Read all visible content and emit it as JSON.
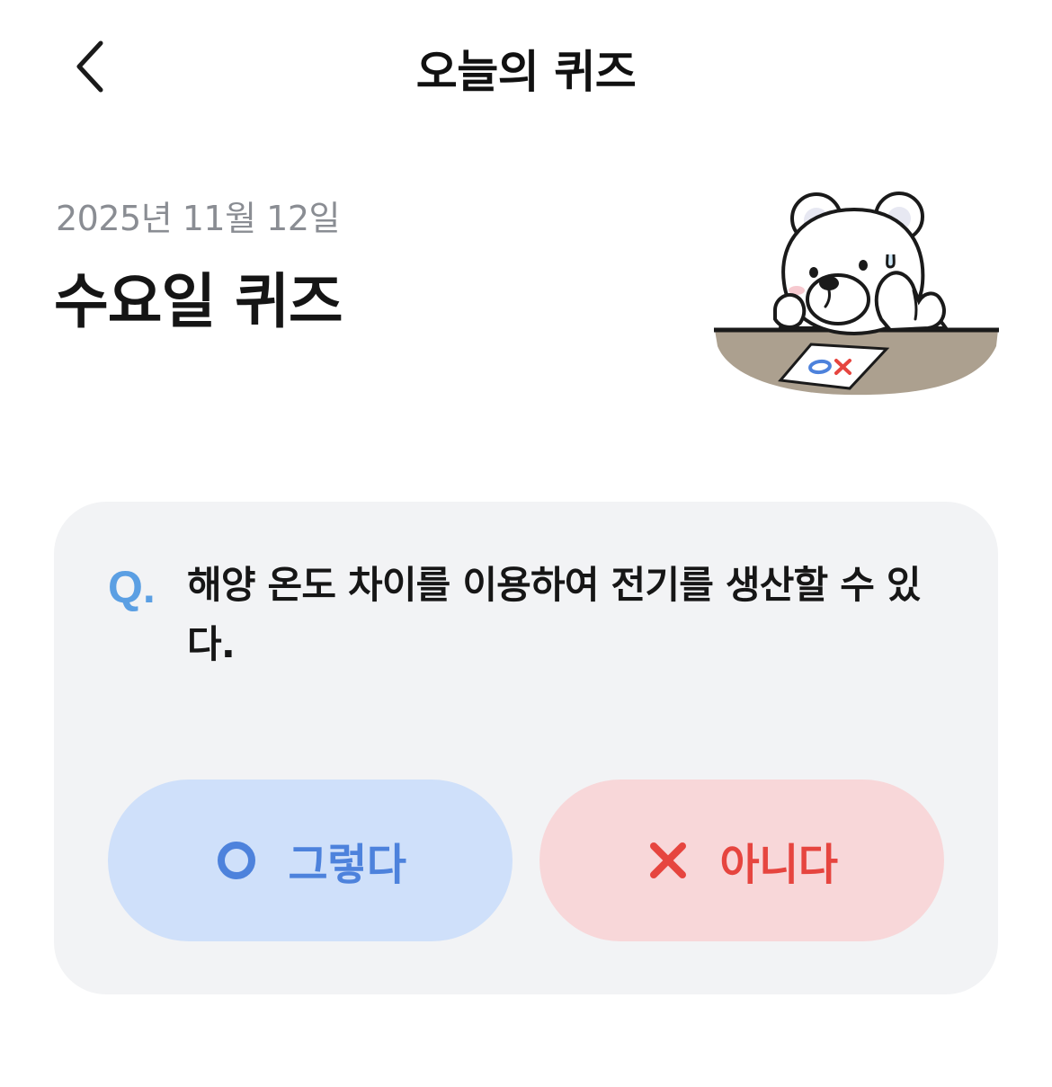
{
  "header": {
    "title": "오늘의 퀴즈",
    "back_icon": "chevron-left-icon"
  },
  "intro": {
    "date": "2025년 11월 12일",
    "title": "수요일 퀴즈",
    "mascot": "polar-bear-with-ox-paper-illustration"
  },
  "quiz": {
    "prefix": "Q.",
    "question": "해양 온도 차이를 이용하여 전기를 생산할 수 있다.",
    "options": [
      {
        "label": "그렇다",
        "icon": "circle-o-icon",
        "color": "#4d82dc",
        "bg": "#cfe0fa"
      },
      {
        "label": "아니다",
        "icon": "x-mark-icon",
        "color": "#e6453f",
        "bg": "#f8d7d9"
      }
    ],
    "accent": "#5b9fe3"
  }
}
